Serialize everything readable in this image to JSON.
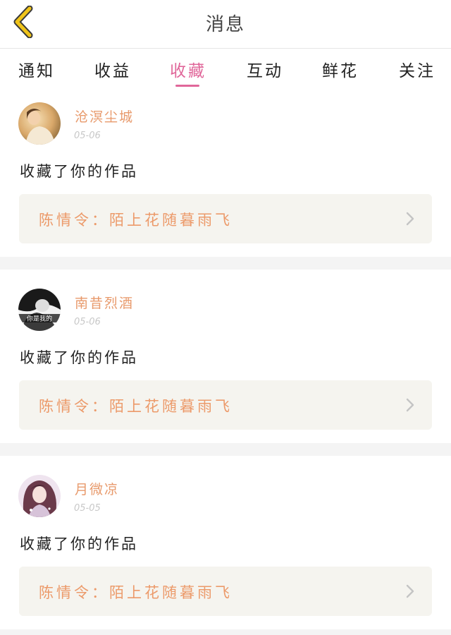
{
  "header": {
    "title": "消息",
    "back_icon": "chevron-left-icon",
    "back_color": "#f0c419"
  },
  "tabs": [
    {
      "label": "通知"
    },
    {
      "label": "收益"
    },
    {
      "label": "收藏",
      "active": true
    },
    {
      "label": "互动"
    },
    {
      "label": "鲜花"
    },
    {
      "label": "关注"
    }
  ],
  "colors": {
    "accent": "#e0679a",
    "username": "#e89a6c",
    "work_title": "#ec9a6a",
    "work_bg": "#f5f4ef"
  },
  "items": [
    {
      "username": "沧溟尘城",
      "date": "05-06",
      "action": "收藏了你的作品",
      "work_title": "陈情令：陌上花随暮雨飞",
      "avatar": "avatar-girl-warm"
    },
    {
      "username": "南昔烈酒",
      "date": "05-06",
      "action": "收藏了你的作品",
      "work_title": "陈情令：陌上花随暮雨飞",
      "avatar": "avatar-couple-bw",
      "avatar_caption": "你是我的"
    },
    {
      "username": "月微凉",
      "date": "05-05",
      "action": "收藏了你的作品",
      "work_title": "陈情令：陌上花随暮雨飞",
      "avatar": "avatar-anime-girl"
    }
  ]
}
